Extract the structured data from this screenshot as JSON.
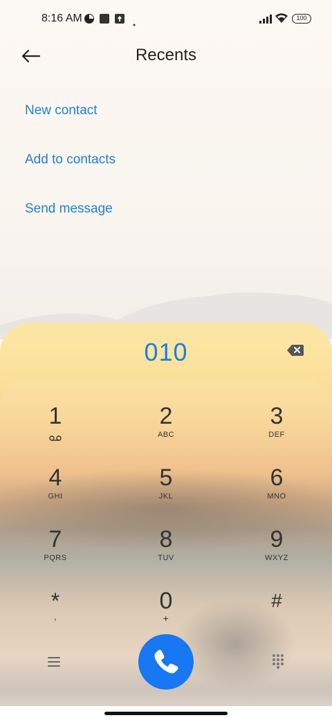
{
  "status_bar": {
    "time": "8:16 AM",
    "battery": "100",
    "icons": [
      "data-saver-icon",
      "notification-square-icon",
      "upload-icon",
      "dot-icon",
      "signal-icon",
      "wifi-icon",
      "battery-icon"
    ]
  },
  "header": {
    "title": "Recents",
    "back_icon": "back-arrow-icon"
  },
  "actions": {
    "new_contact": "New contact",
    "add_to_contacts": "Add to contacts",
    "send_message": "Send message"
  },
  "dialer": {
    "number": "010",
    "keys": [
      {
        "digit": "1",
        "letters": ""
      },
      {
        "digit": "2",
        "letters": "ABC"
      },
      {
        "digit": "3",
        "letters": "DEF"
      },
      {
        "digit": "4",
        "letters": "GHI"
      },
      {
        "digit": "5",
        "letters": "JKL"
      },
      {
        "digit": "6",
        "letters": "MNO"
      },
      {
        "digit": "7",
        "letters": "PQRS"
      },
      {
        "digit": "8",
        "letters": "TUV"
      },
      {
        "digit": "9",
        "letters": "WXYZ"
      },
      {
        "digit": "*",
        "letters": ","
      },
      {
        "digit": "0",
        "letters": "+"
      },
      {
        "digit": "#",
        "letters": ""
      }
    ],
    "key1_sub_icon": "voicemail-icon",
    "bottom_icons": [
      "menu-icon",
      "phone-icon",
      "dialpad-icon"
    ]
  },
  "colors": {
    "accent": "#1f7fdc",
    "call_button": "#1877f2"
  }
}
